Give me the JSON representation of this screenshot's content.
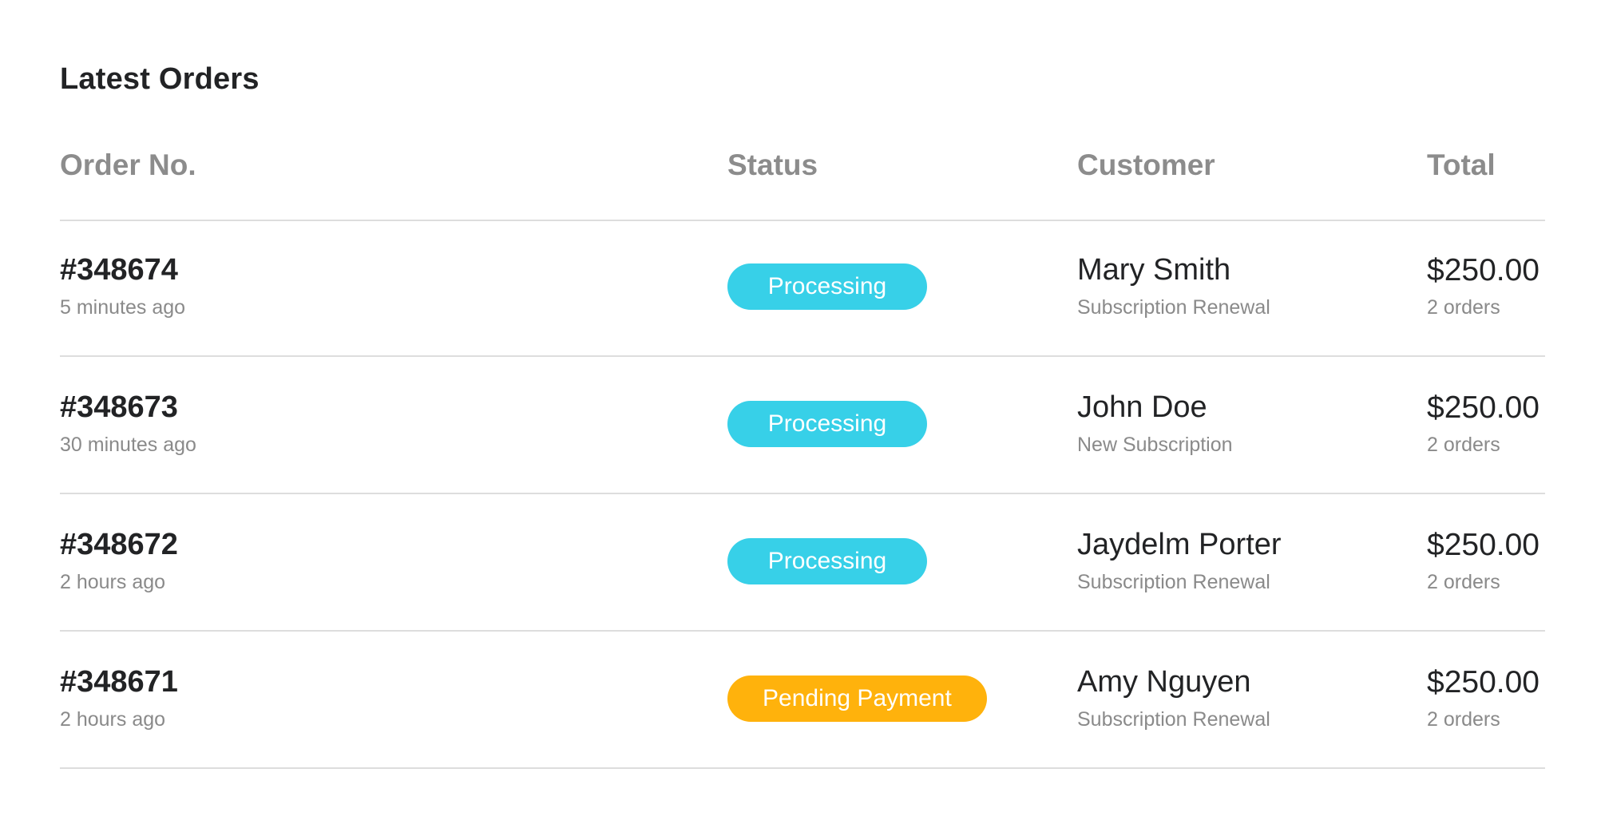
{
  "panel": {
    "title": "Latest Orders"
  },
  "table": {
    "headers": [
      "Order No.",
      "Status",
      "Customer",
      "Total"
    ],
    "rows": [
      {
        "order_no": "#348674",
        "time": "5 minutes ago",
        "status": "Processing",
        "status_color": "#37d0e8",
        "customer": "Mary Smith",
        "customer_type": "Subscription Renewal",
        "total": "$250.00",
        "orders": "2 orders"
      },
      {
        "order_no": "#348673",
        "time": "30 minutes ago",
        "status": "Processing",
        "status_color": "#37d0e8",
        "customer": "John Doe",
        "customer_type": "New Subscription",
        "total": "$250.00",
        "orders": "2 orders"
      },
      {
        "order_no": "#348672",
        "time": "2 hours ago",
        "status": "Processing",
        "status_color": "#37d0e8",
        "customer": "Jaydelm Porter",
        "customer_type": "Subscription Renewal",
        "total": "$250.00",
        "orders": "2 orders"
      },
      {
        "order_no": "#348671",
        "time": "2 hours ago",
        "status": "Pending Payment",
        "status_color": "#ffb20c",
        "customer": "Amy Nguyen",
        "customer_type": "Subscription Renewal",
        "total": "$250.00",
        "orders": "2 orders"
      }
    ]
  }
}
